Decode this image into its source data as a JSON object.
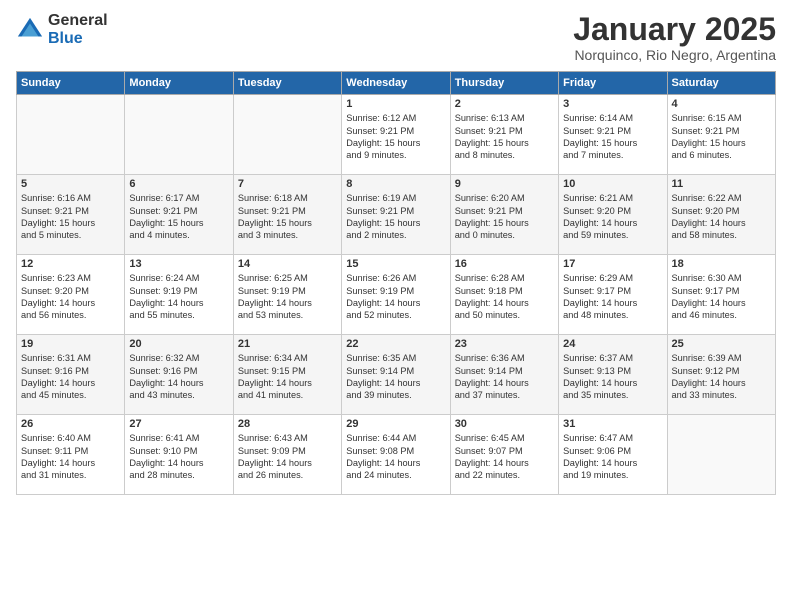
{
  "logo": {
    "general": "General",
    "blue": "Blue"
  },
  "title": "January 2025",
  "subtitle": "Norquinco, Rio Negro, Argentina",
  "days_of_week": [
    "Sunday",
    "Monday",
    "Tuesday",
    "Wednesday",
    "Thursday",
    "Friday",
    "Saturday"
  ],
  "weeks": [
    [
      {
        "day": "",
        "content": ""
      },
      {
        "day": "",
        "content": ""
      },
      {
        "day": "",
        "content": ""
      },
      {
        "day": "1",
        "content": "Sunrise: 6:12 AM\nSunset: 9:21 PM\nDaylight: 15 hours\nand 9 minutes."
      },
      {
        "day": "2",
        "content": "Sunrise: 6:13 AM\nSunset: 9:21 PM\nDaylight: 15 hours\nand 8 minutes."
      },
      {
        "day": "3",
        "content": "Sunrise: 6:14 AM\nSunset: 9:21 PM\nDaylight: 15 hours\nand 7 minutes."
      },
      {
        "day": "4",
        "content": "Sunrise: 6:15 AM\nSunset: 9:21 PM\nDaylight: 15 hours\nand 6 minutes."
      }
    ],
    [
      {
        "day": "5",
        "content": "Sunrise: 6:16 AM\nSunset: 9:21 PM\nDaylight: 15 hours\nand 5 minutes."
      },
      {
        "day": "6",
        "content": "Sunrise: 6:17 AM\nSunset: 9:21 PM\nDaylight: 15 hours\nand 4 minutes."
      },
      {
        "day": "7",
        "content": "Sunrise: 6:18 AM\nSunset: 9:21 PM\nDaylight: 15 hours\nand 3 minutes."
      },
      {
        "day": "8",
        "content": "Sunrise: 6:19 AM\nSunset: 9:21 PM\nDaylight: 15 hours\nand 2 minutes."
      },
      {
        "day": "9",
        "content": "Sunrise: 6:20 AM\nSunset: 9:21 PM\nDaylight: 15 hours\nand 0 minutes."
      },
      {
        "day": "10",
        "content": "Sunrise: 6:21 AM\nSunset: 9:20 PM\nDaylight: 14 hours\nand 59 minutes."
      },
      {
        "day": "11",
        "content": "Sunrise: 6:22 AM\nSunset: 9:20 PM\nDaylight: 14 hours\nand 58 minutes."
      }
    ],
    [
      {
        "day": "12",
        "content": "Sunrise: 6:23 AM\nSunset: 9:20 PM\nDaylight: 14 hours\nand 56 minutes."
      },
      {
        "day": "13",
        "content": "Sunrise: 6:24 AM\nSunset: 9:19 PM\nDaylight: 14 hours\nand 55 minutes."
      },
      {
        "day": "14",
        "content": "Sunrise: 6:25 AM\nSunset: 9:19 PM\nDaylight: 14 hours\nand 53 minutes."
      },
      {
        "day": "15",
        "content": "Sunrise: 6:26 AM\nSunset: 9:19 PM\nDaylight: 14 hours\nand 52 minutes."
      },
      {
        "day": "16",
        "content": "Sunrise: 6:28 AM\nSunset: 9:18 PM\nDaylight: 14 hours\nand 50 minutes."
      },
      {
        "day": "17",
        "content": "Sunrise: 6:29 AM\nSunset: 9:17 PM\nDaylight: 14 hours\nand 48 minutes."
      },
      {
        "day": "18",
        "content": "Sunrise: 6:30 AM\nSunset: 9:17 PM\nDaylight: 14 hours\nand 46 minutes."
      }
    ],
    [
      {
        "day": "19",
        "content": "Sunrise: 6:31 AM\nSunset: 9:16 PM\nDaylight: 14 hours\nand 45 minutes."
      },
      {
        "day": "20",
        "content": "Sunrise: 6:32 AM\nSunset: 9:16 PM\nDaylight: 14 hours\nand 43 minutes."
      },
      {
        "day": "21",
        "content": "Sunrise: 6:34 AM\nSunset: 9:15 PM\nDaylight: 14 hours\nand 41 minutes."
      },
      {
        "day": "22",
        "content": "Sunrise: 6:35 AM\nSunset: 9:14 PM\nDaylight: 14 hours\nand 39 minutes."
      },
      {
        "day": "23",
        "content": "Sunrise: 6:36 AM\nSunset: 9:14 PM\nDaylight: 14 hours\nand 37 minutes."
      },
      {
        "day": "24",
        "content": "Sunrise: 6:37 AM\nSunset: 9:13 PM\nDaylight: 14 hours\nand 35 minutes."
      },
      {
        "day": "25",
        "content": "Sunrise: 6:39 AM\nSunset: 9:12 PM\nDaylight: 14 hours\nand 33 minutes."
      }
    ],
    [
      {
        "day": "26",
        "content": "Sunrise: 6:40 AM\nSunset: 9:11 PM\nDaylight: 14 hours\nand 31 minutes."
      },
      {
        "day": "27",
        "content": "Sunrise: 6:41 AM\nSunset: 9:10 PM\nDaylight: 14 hours\nand 28 minutes."
      },
      {
        "day": "28",
        "content": "Sunrise: 6:43 AM\nSunset: 9:09 PM\nDaylight: 14 hours\nand 26 minutes."
      },
      {
        "day": "29",
        "content": "Sunrise: 6:44 AM\nSunset: 9:08 PM\nDaylight: 14 hours\nand 24 minutes."
      },
      {
        "day": "30",
        "content": "Sunrise: 6:45 AM\nSunset: 9:07 PM\nDaylight: 14 hours\nand 22 minutes."
      },
      {
        "day": "31",
        "content": "Sunrise: 6:47 AM\nSunset: 9:06 PM\nDaylight: 14 hours\nand 19 minutes."
      },
      {
        "day": "",
        "content": ""
      }
    ]
  ]
}
